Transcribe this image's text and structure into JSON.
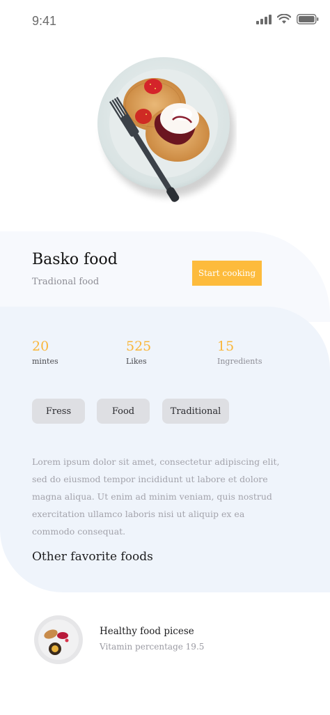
{
  "status_bar": {
    "time": "9:41",
    "icons": [
      "signal-icon",
      "wifi-icon",
      "battery-icon"
    ]
  },
  "hero": {
    "image": "pancake-plate-image"
  },
  "recipe": {
    "title": "Basko food",
    "subtitle": "Tradional food",
    "start_label": "Start cooking",
    "accent_color": "#fdbb3c"
  },
  "stats": [
    {
      "value": "20",
      "label": "mintes"
    },
    {
      "value": "525",
      "label": "Likes"
    },
    {
      "value": "15",
      "label": "Ingredients"
    }
  ],
  "tags": [
    "Fress",
    "Food",
    "Traditional"
  ],
  "description": "Lorem ipsum dolor sit amet, consectetur adipiscing elit, sed do eiusmod tempor incididunt ut labore et dolore magna aliqua. Ut enim ad minim veniam, quis nostrud exercitation ullamco laboris nisi ut aliquip ex ea commodo consequat.",
  "other_section": {
    "title": "Other favorite foods",
    "items": [
      {
        "name": "Healthy food picese",
        "meta": "Vitamin percentage 19.5",
        "image": "dessert-plate-image"
      }
    ]
  }
}
